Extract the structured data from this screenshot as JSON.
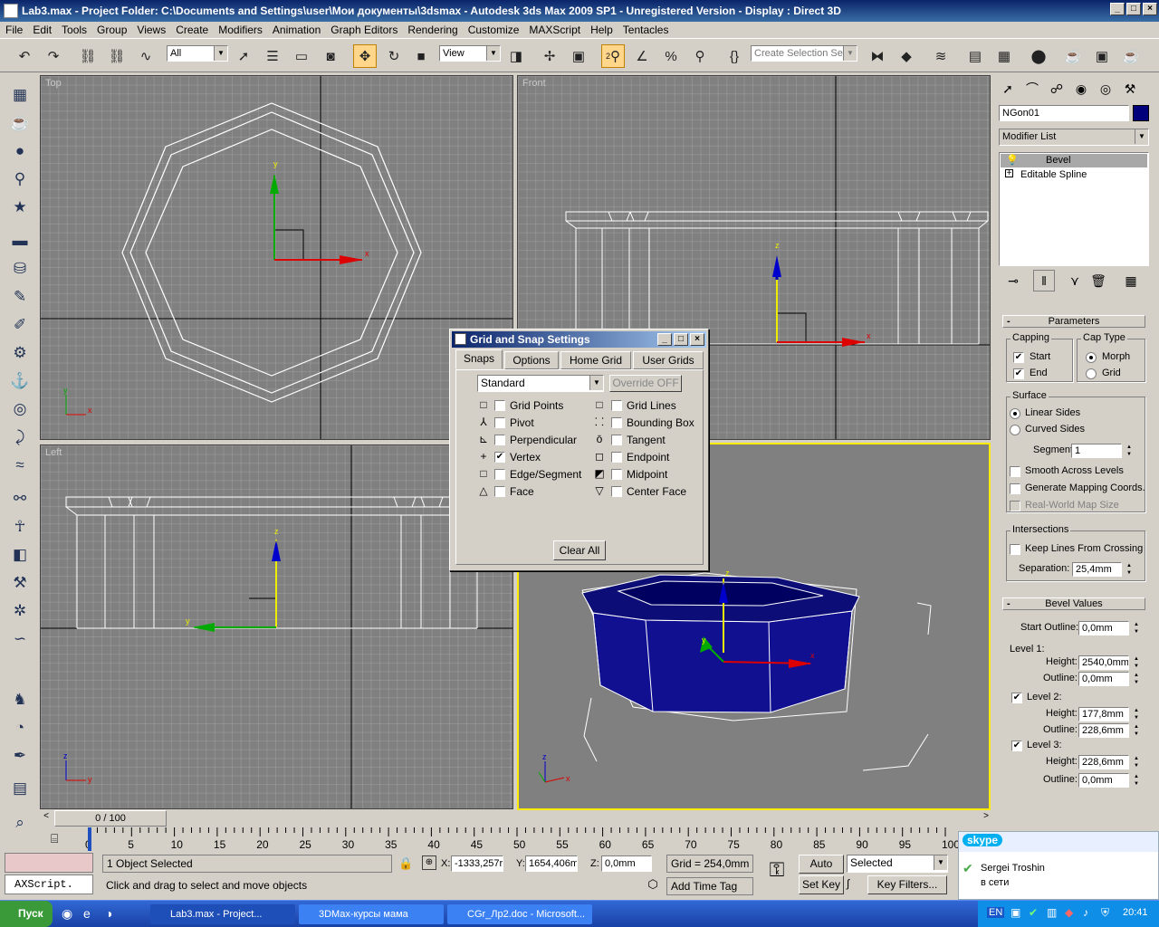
{
  "window": {
    "title": "Lab3.max      - Project Folder: C:\\Documents and Settings\\user\\Мои документы\\3dsmax      - Autodesk 3ds Max  2009 SP1   - Unregistered Version      - Display : Direct 3D"
  },
  "menu": [
    "File",
    "Edit",
    "Tools",
    "Group",
    "Views",
    "Create",
    "Modifiers",
    "Animation",
    "Graph Editors",
    "Rendering",
    "Customize",
    "MAXScript",
    "Help",
    "Tentacles"
  ],
  "toolbar": {
    "filter_value": "All",
    "refcoord_value": "View",
    "selection_set_placeholder": "Create Selection Set",
    "snap_number": "2"
  },
  "viewports": {
    "top": "Top",
    "front": "Front",
    "left": "Left"
  },
  "axis": {
    "x": "x",
    "y": "y",
    "z": "z"
  },
  "command_panel": {
    "object_name": "NGon01",
    "object_color": "#00007a",
    "modifier_list": "Modifier List",
    "stack": [
      "Bevel",
      "Editable Spline"
    ],
    "parameters": {
      "title": "Parameters",
      "capping": "Capping",
      "start": "Start",
      "end": "End",
      "cap_type": "Cap Type",
      "morph": "Morph",
      "grid": "Grid",
      "surface": "Surface",
      "linear_sides": "Linear Sides",
      "curved_sides": "Curved Sides",
      "segments_label": "Segments:",
      "segments_value": "1",
      "smooth": "Smooth Across Levels",
      "gen_mapping": "Generate Mapping Coords.",
      "real_world": "Real-World Map Size",
      "intersections": "Intersections",
      "keep_lines": "Keep Lines From Crossing",
      "separation_label": "Separation:",
      "separation_value": "25,4mm"
    },
    "bevel_values": {
      "title": "Bevel Values",
      "start_outline_label": "Start Outline:",
      "start_outline": "0,0mm",
      "level1": "Level 1:",
      "height_label": "Height:",
      "outline_label": "Outline:",
      "l1_height": "2540,0mm",
      "l1_outline": "0,0mm",
      "level2": "Level 2:",
      "l2_height": "177,8mm",
      "l2_outline": "228,6mm",
      "level3": "Level 3:",
      "l3_height": "228,6mm",
      "l3_outline": "0,0mm"
    }
  },
  "dialog": {
    "title": "Grid and Snap Settings",
    "tabs": [
      "Snaps",
      "Options",
      "Home Grid",
      "User Grids"
    ],
    "preset": "Standard",
    "override": "Override OFF",
    "snaps_left": [
      {
        "label": "Grid Points",
        "checked": false
      },
      {
        "label": "Pivot",
        "checked": false
      },
      {
        "label": "Perpendicular",
        "checked": false
      },
      {
        "label": "Vertex",
        "checked": true
      },
      {
        "label": "Edge/Segment",
        "checked": false
      },
      {
        "label": "Face",
        "checked": false
      }
    ],
    "snaps_right": [
      {
        "label": "Grid Lines",
        "checked": false
      },
      {
        "label": "Bounding Box",
        "checked": false
      },
      {
        "label": "Tangent",
        "checked": false
      },
      {
        "label": "Endpoint",
        "checked": false
      },
      {
        "label": "Midpoint",
        "checked": false
      },
      {
        "label": "Center Face",
        "checked": false
      }
    ],
    "clear_all": "Clear All"
  },
  "timeline": {
    "frame": "0 / 100",
    "ticks": [
      "0",
      "5",
      "10",
      "15",
      "20",
      "25",
      "30",
      "35",
      "40",
      "45",
      "50",
      "55",
      "60",
      "65",
      "70",
      "75",
      "80",
      "85",
      "90",
      "95",
      "100"
    ]
  },
  "status": {
    "maxscript": "AXScript.",
    "selected": "1 Object Selected",
    "prompt": "Click and drag to select and move objects",
    "x_label": "X:",
    "x": "-1333,257r",
    "y_label": "Y:",
    "y": "1654,406m",
    "z_label": "Z:",
    "z": "0,0mm",
    "grid": "Grid = 254,0mm",
    "add_time_tag": "Add Time Tag",
    "auto_key": "Auto Key",
    "set_key": "Set Key",
    "key_mode": "Selected",
    "key_filters": "Key Filters..."
  },
  "skype": {
    "brand": "skype",
    "user": "Sergei Troshin",
    "status": "в сети"
  },
  "taskbar": {
    "start": "Пуск",
    "tasks": [
      "Lab3.max      - Project...",
      "3DMax-курсы мама",
      "CGr_Лр2.doc - Microsoft..."
    ],
    "lang": "EN",
    "clock": "20:41"
  }
}
